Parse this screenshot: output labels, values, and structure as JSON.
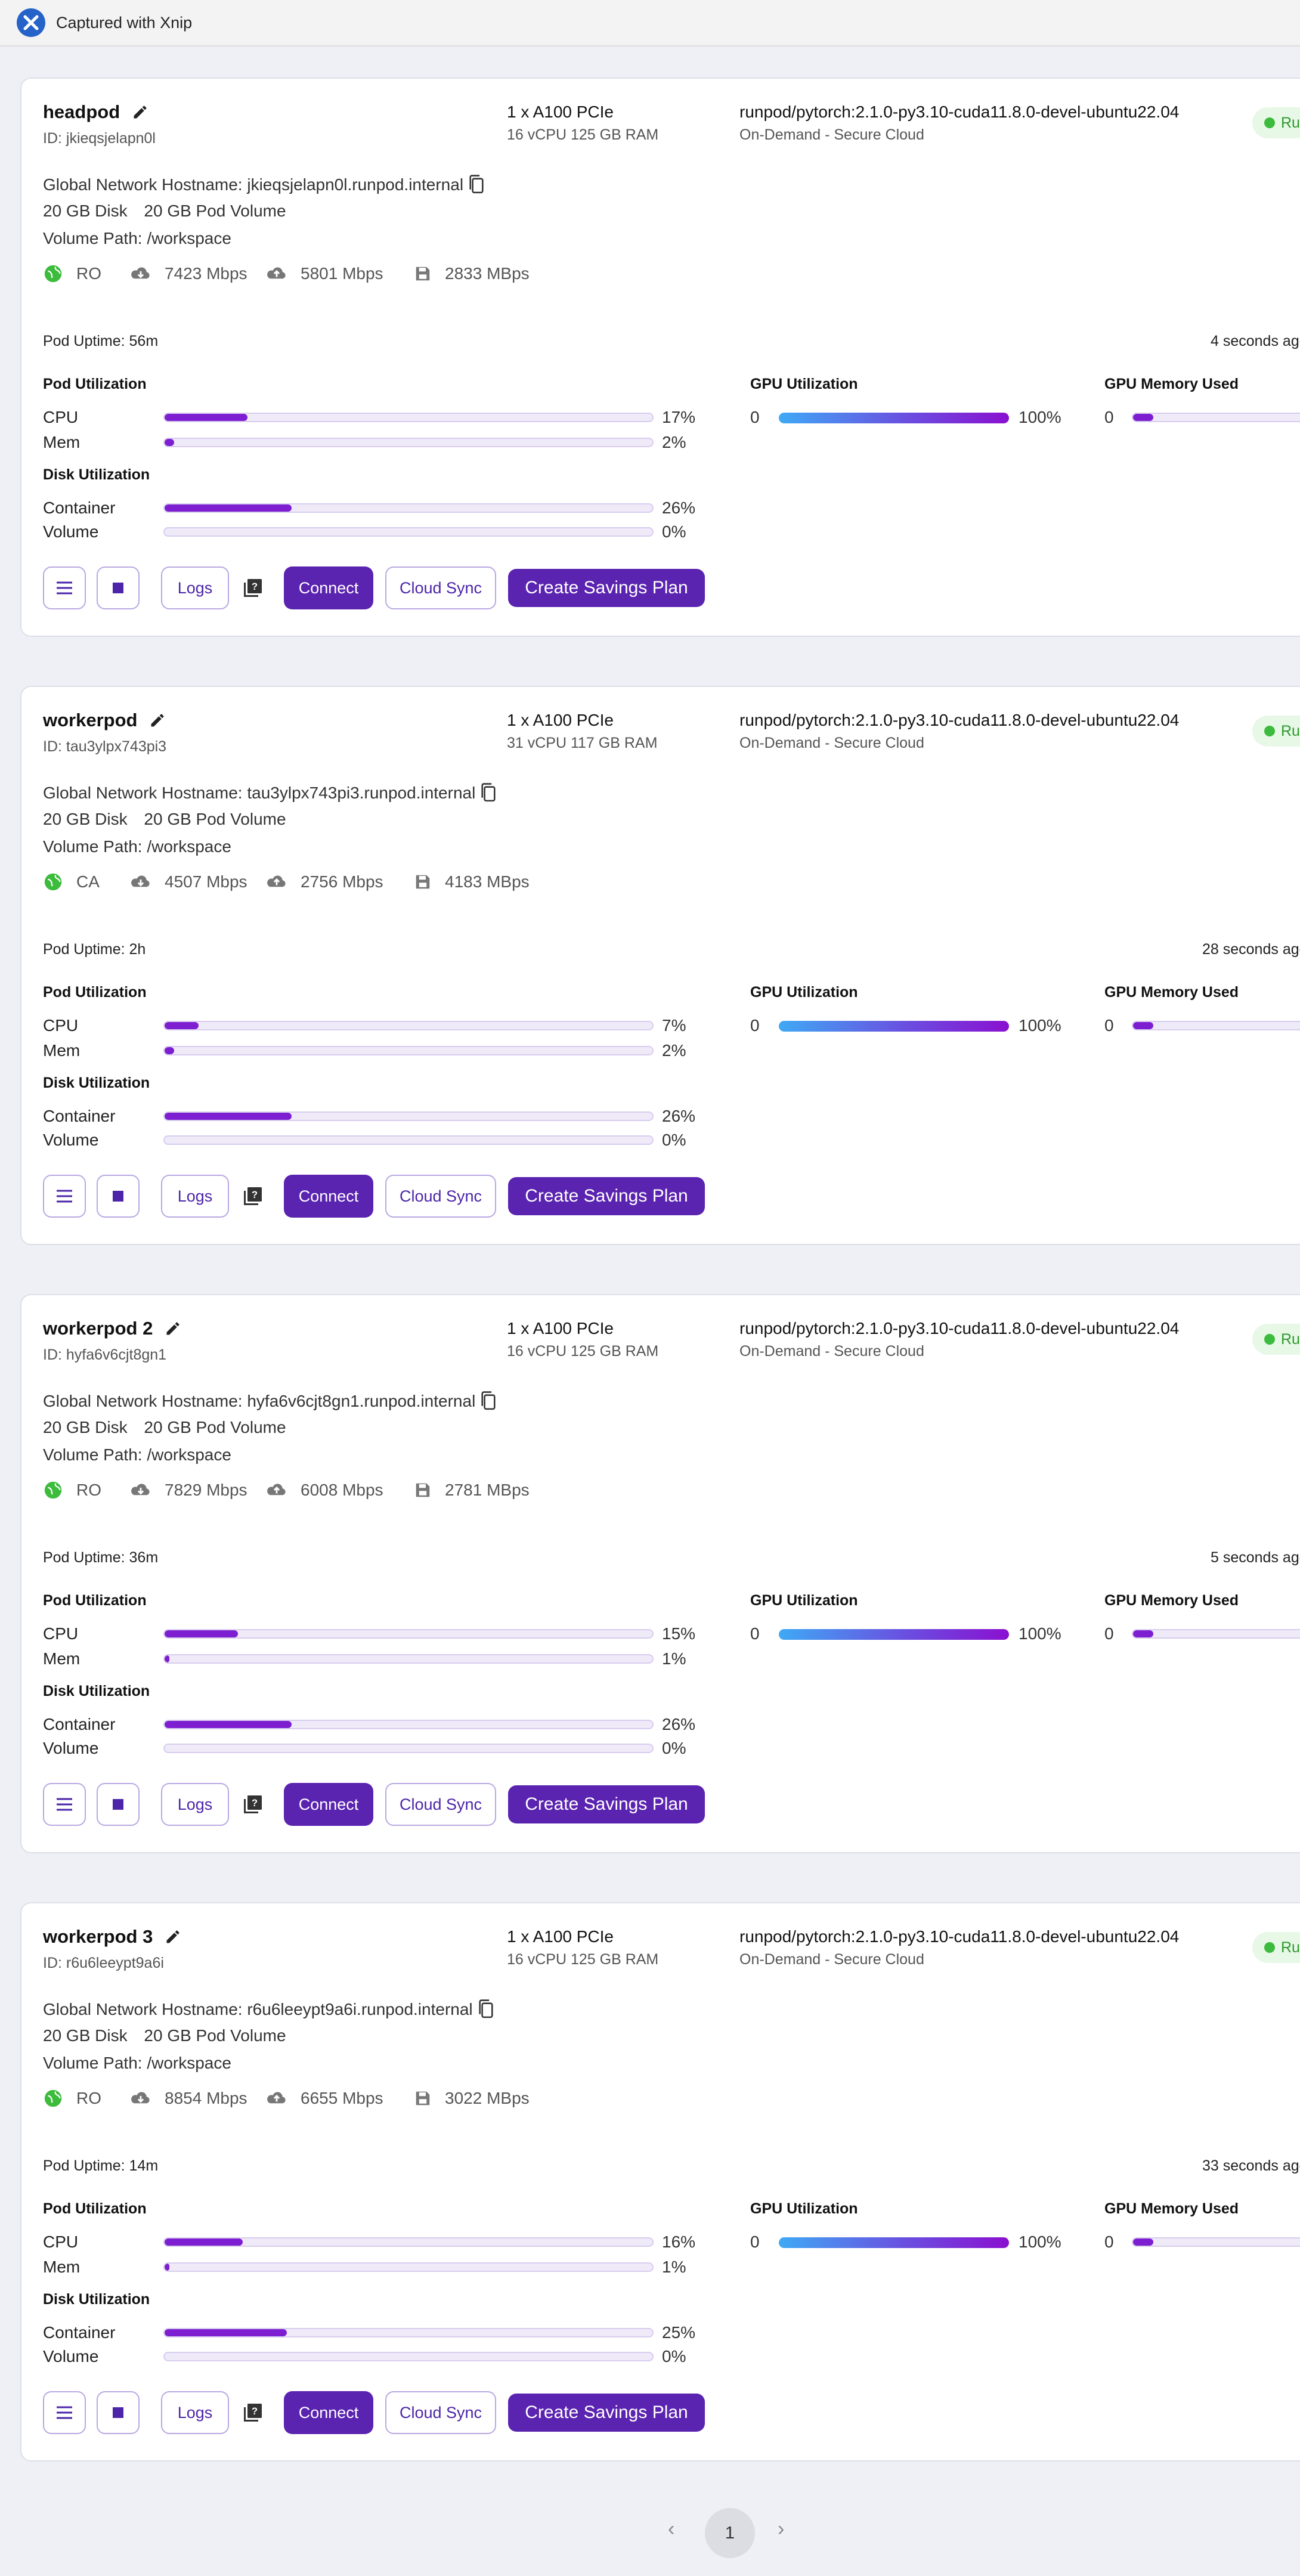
{
  "app": {
    "title": "Captured with Xnip"
  },
  "labels": {
    "pod_utilization": "Pod Utilization",
    "disk_utilization": "Disk Utilization",
    "gpu_utilization": "GPU Utilization",
    "gpu_memory_used": "GPU Memory Used",
    "cpu": "CPU",
    "mem": "Mem",
    "container": "Container",
    "volume": "Volume",
    "gpu_zero": "0",
    "gpu_mem_zero": "0",
    "logs": "Logs",
    "connect": "Connect",
    "cloud_sync": "Cloud Sync",
    "create_savings_plan": "Create Savings Plan",
    "status": "Running"
  },
  "colors": {
    "accent": "#5a23b0",
    "bar": "#7d1fd1",
    "status_green": "#3dbb3d"
  },
  "pods": [
    {
      "name": "headpod",
      "id": "ID: jkieqsjelapn0l",
      "gpu": "1 x A100 PCIe",
      "specs": "16 vCPU 125 GB RAM",
      "image": "runpod/pytorch:2.1.0-py3.10-cuda11.8.0-devel-ubuntu22.04",
      "cloud": "On-Demand - Secure Cloud",
      "hostname": "Global Network Hostname: jkieqsjelapn0l.runpod.internal",
      "disk": "20 GB Disk",
      "pod_volume": "20 GB Pod Volume",
      "volume_path": "Volume Path: /workspace",
      "region": "RO",
      "download": "7423 Mbps",
      "upload": "5801 Mbps",
      "disk_speed": "2833 MBps",
      "uptime": "Pod Uptime: 56m",
      "updated": "4 seconds ago",
      "cpu_pct": "17%",
      "mem_pct": "2%",
      "container_pct": "26%",
      "volume_pct": "0%",
      "gpu_pct": "100%",
      "cpu_val": 17,
      "mem_val": 2,
      "container_val": 26,
      "volume_val": 0,
      "gpu_val": 100
    },
    {
      "name": "workerpod",
      "id": "ID: tau3ylpx743pi3",
      "gpu": "1 x A100 PCIe",
      "specs": "31 vCPU 117 GB RAM",
      "image": "runpod/pytorch:2.1.0-py3.10-cuda11.8.0-devel-ubuntu22.04",
      "cloud": "On-Demand - Secure Cloud",
      "hostname": "Global Network Hostname: tau3ylpx743pi3.runpod.internal",
      "disk": "20 GB Disk",
      "pod_volume": "20 GB Pod Volume",
      "volume_path": "Volume Path: /workspace",
      "region": "CA",
      "download": "4507 Mbps",
      "upload": "2756 Mbps",
      "disk_speed": "4183 MBps",
      "uptime": "Pod Uptime: 2h",
      "updated": "28 seconds ago",
      "cpu_pct": "7%",
      "mem_pct": "2%",
      "container_pct": "26%",
      "volume_pct": "0%",
      "gpu_pct": "100%",
      "cpu_val": 7,
      "mem_val": 2,
      "container_val": 26,
      "volume_val": 0,
      "gpu_val": 100
    },
    {
      "name": "workerpod 2",
      "id": "ID: hyfa6v6cjt8gn1",
      "gpu": "1 x A100 PCIe",
      "specs": "16 vCPU 125 GB RAM",
      "image": "runpod/pytorch:2.1.0-py3.10-cuda11.8.0-devel-ubuntu22.04",
      "cloud": "On-Demand - Secure Cloud",
      "hostname": "Global Network Hostname: hyfa6v6cjt8gn1.runpod.internal",
      "disk": "20 GB Disk",
      "pod_volume": "20 GB Pod Volume",
      "volume_path": "Volume Path: /workspace",
      "region": "RO",
      "download": "7829 Mbps",
      "upload": "6008 Mbps",
      "disk_speed": "2781 MBps",
      "uptime": "Pod Uptime: 36m",
      "updated": "5 seconds ago",
      "cpu_pct": "15%",
      "mem_pct": "1%",
      "container_pct": "26%",
      "volume_pct": "0%",
      "gpu_pct": "100%",
      "cpu_val": 15,
      "mem_val": 1,
      "container_val": 26,
      "volume_val": 0,
      "gpu_val": 100
    },
    {
      "name": "workerpod 3",
      "id": "ID: r6u6leeypt9a6i",
      "gpu": "1 x A100 PCIe",
      "specs": "16 vCPU 125 GB RAM",
      "image": "runpod/pytorch:2.1.0-py3.10-cuda11.8.0-devel-ubuntu22.04",
      "cloud": "On-Demand - Secure Cloud",
      "hostname": "Global Network Hostname: r6u6leeypt9a6i.runpod.internal",
      "disk": "20 GB Disk",
      "pod_volume": "20 GB Pod Volume",
      "volume_path": "Volume Path: /workspace",
      "region": "RO",
      "download": "8854 Mbps",
      "upload": "6655 Mbps",
      "disk_speed": "3022 MBps",
      "uptime": "Pod Uptime: 14m",
      "updated": "33 seconds ago",
      "cpu_pct": "16%",
      "mem_pct": "1%",
      "container_pct": "25%",
      "volume_pct": "0%",
      "gpu_pct": "100%",
      "cpu_val": 16,
      "mem_val": 1,
      "container_val": 25,
      "volume_val": 0,
      "gpu_val": 100
    }
  ],
  "pagination": {
    "current_page": "1",
    "prev": "‹",
    "next": "›"
  }
}
